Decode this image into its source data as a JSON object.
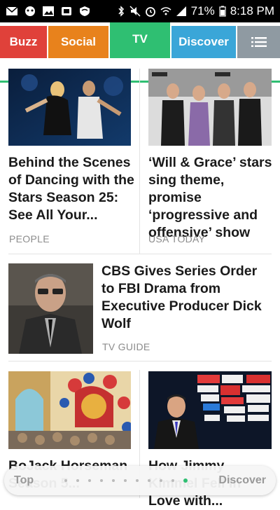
{
  "status_bar": {
    "battery": "71%",
    "time": "8:18 PM"
  },
  "tabs": [
    {
      "label": "Buzz"
    },
    {
      "label": "Social"
    },
    {
      "label": "TV"
    },
    {
      "label": "Discover"
    }
  ],
  "colors": {
    "buzz": "#e0413a",
    "social": "#e8821c",
    "tv": "#2fbf72",
    "discover": "#3aa6d8",
    "menu": "#8f9aa2"
  },
  "articles": [
    {
      "headline": "Behind the Scenes of Dancing with the Stars Season 25: See All Your...",
      "source": "PEOPLE"
    },
    {
      "headline": "‘Will & Grace’ stars sing theme, promise ‘progressive and offensive’ show",
      "source": "USA TODAY"
    },
    {
      "headline": "CBS Gives Series Order to FBI Drama from Executive Producer Dick Wolf",
      "source": "TV GUIDE"
    },
    {
      "headline": "BoJack Horseman Season 5...",
      "source": ""
    },
    {
      "headline": "How Jimmy Kimmel Fell In Love with...",
      "source": ""
    }
  ],
  "bottom_bar": {
    "top_label": "Top",
    "discover_label": "Discover"
  }
}
